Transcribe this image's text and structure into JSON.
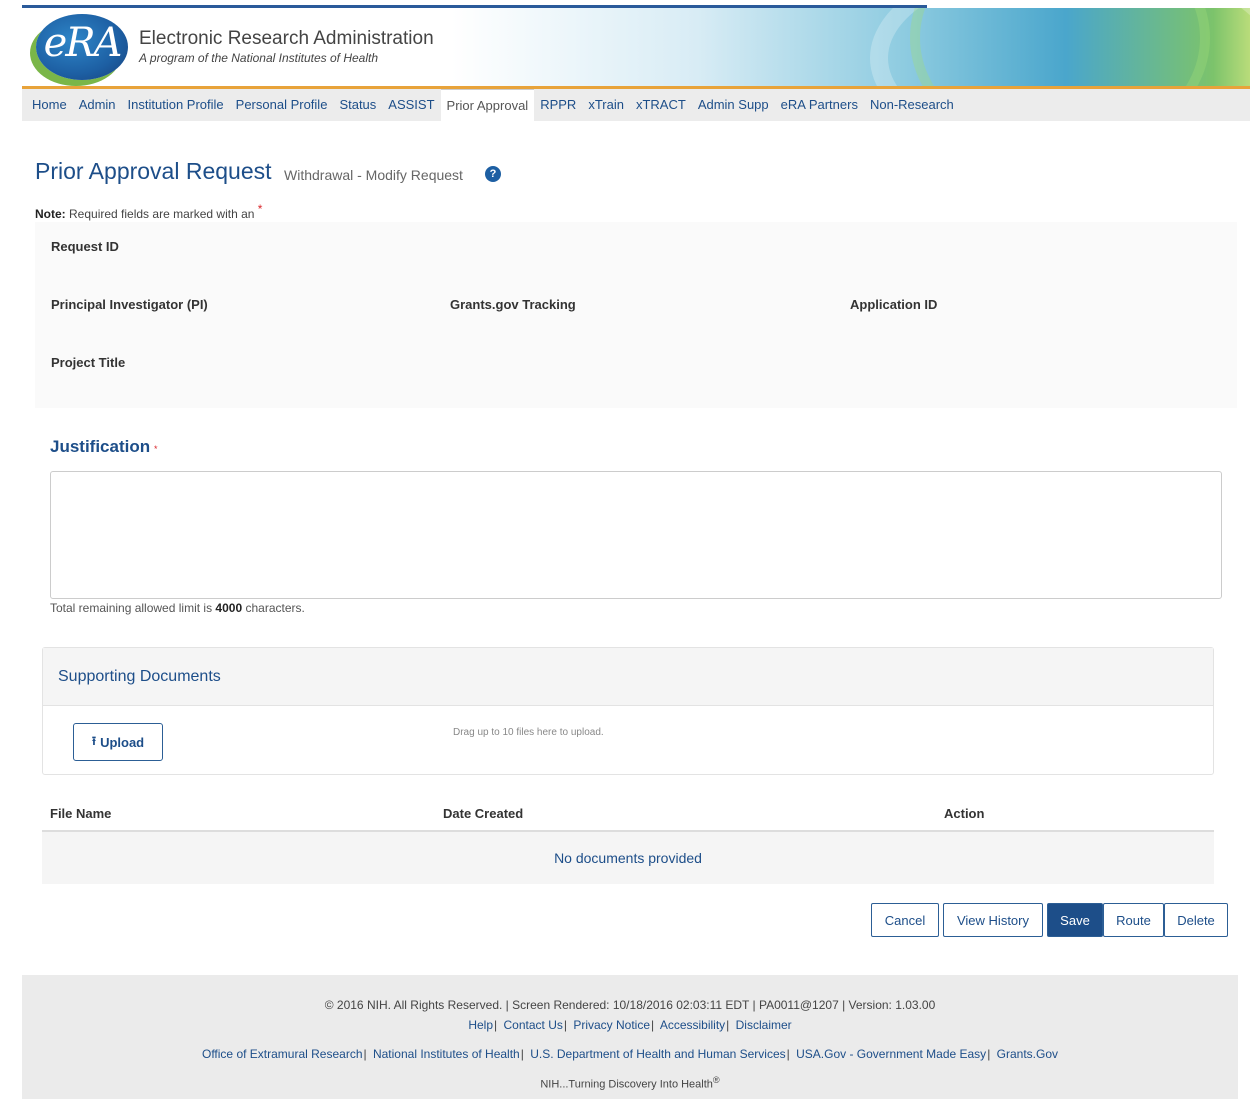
{
  "header": {
    "logo_text": "eRA",
    "title": "Electronic Research Administration",
    "subtitle": "A program of the National Institutes of Health"
  },
  "nav": {
    "items": [
      {
        "label": "Home",
        "active": false
      },
      {
        "label": "Admin",
        "active": false
      },
      {
        "label": "Institution Profile",
        "active": false
      },
      {
        "label": "Personal Profile",
        "active": false
      },
      {
        "label": "Status",
        "active": false
      },
      {
        "label": "ASSIST",
        "active": false
      },
      {
        "label": "Prior Approval",
        "active": true
      },
      {
        "label": "RPPR",
        "active": false
      },
      {
        "label": "xTrain",
        "active": false
      },
      {
        "label": "xTRACT",
        "active": false
      },
      {
        "label": "Admin Supp",
        "active": false
      },
      {
        "label": "eRA Partners",
        "active": false
      },
      {
        "label": "Non-Research",
        "active": false
      }
    ]
  },
  "page": {
    "title": "Prior Approval Request",
    "subtitle": "Withdrawal - Modify Request",
    "help_icon": "question-circle-icon",
    "note_label": "Note:",
    "note_text": "Required fields are marked with an",
    "required_marker": "*"
  },
  "request_info": {
    "request_id_label": "Request ID",
    "pi_label": "Principal Investigator (PI)",
    "tracking_label": "Grants.gov Tracking",
    "application_id_label": "Application ID",
    "project_title_label": "Project Title"
  },
  "justification": {
    "label": "Justification",
    "required_marker": "*",
    "value": "",
    "remaining_prefix": "Total remaining allowed limit is",
    "remaining_count": "4000",
    "remaining_suffix": "characters."
  },
  "supporting_documents": {
    "title": "Supporting Documents",
    "upload_label": "Upload",
    "upload_icon": "upload-icon",
    "drag_hint": "Drag up to 10 files here to upload."
  },
  "documents_table": {
    "columns": [
      "File Name",
      "Date Created",
      "Action"
    ],
    "empty_message": "No documents provided"
  },
  "actions": {
    "cancel": "Cancel",
    "view_history": "View History",
    "save": "Save",
    "route": "Route",
    "delete": "Delete"
  },
  "footer": {
    "copyright": "© 2016 NIH. All Rights Reserved. | Screen Rendered:  10/18/2016 02:03:11 EDT | PA0011@1207 | Version: 1.03.00",
    "links1": [
      "Help",
      "Contact Us",
      "Privacy Notice",
      "Accessibility",
      "Disclaimer"
    ],
    "links2": [
      "Office of Extramural Research",
      "National Institutes of Health",
      "U.S. Department of Health and Human Services",
      "USA.Gov - Government Made Easy",
      "Grants.Gov"
    ],
    "tagline": "NIH...Turning Discovery Into Health",
    "tagline_mark": "®"
  },
  "colors": {
    "brand_blue": "#1d4e89",
    "accent_orange": "#e8a33a",
    "required_red": "#d9262b"
  }
}
